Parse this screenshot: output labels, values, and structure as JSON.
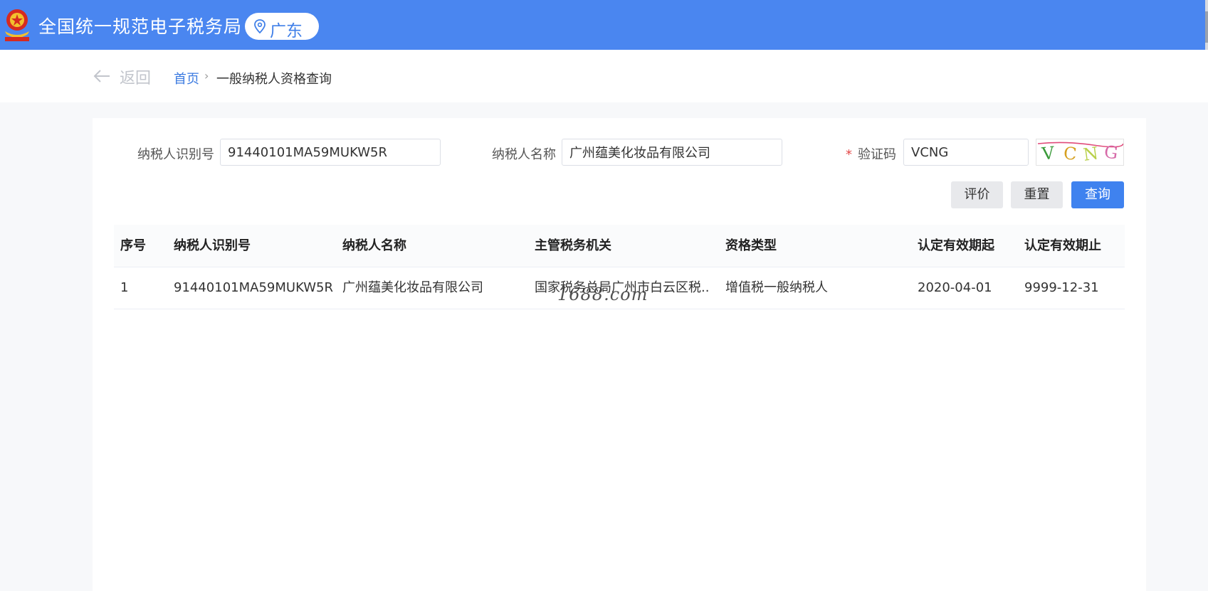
{
  "header": {
    "title": "全国统一规范电子税务局",
    "region": "广东",
    "emblem_icon": "national-emblem-icon",
    "region_icon": "location-pin-icon",
    "brand_color": "#4a86f0"
  },
  "nav": {
    "back_label": "返回",
    "breadcrumb": {
      "home": "首页",
      "separator": "›",
      "current": "一般纳税人资格查询"
    }
  },
  "form": {
    "taxpayer_id_label": "纳税人识别号",
    "taxpayer_id_value": "91440101MA59MUKW5R",
    "taxpayer_name_label": "纳税人名称",
    "taxpayer_name_value": "广州蕴美化妆品有限公司",
    "captcha_required_mark": "*",
    "captcha_label": "验证码",
    "captcha_value": "VCNG",
    "captcha_image_text": "VCNG"
  },
  "buttons": {
    "evaluate": "评价",
    "reset": "重置",
    "query": "查询"
  },
  "table": {
    "columns": [
      "序号",
      "纳税人识别号",
      "纳税人名称",
      "主管税务机关",
      "资格类型",
      "认定有效期起",
      "认定有效期止"
    ],
    "rows": [
      [
        "1",
        "91440101MA59MUKW5R",
        "广州蕴美化妆品有限公司",
        "国家税务总局广州市白云区税...",
        "增值税一般纳税人",
        "2020-04-01",
        "9999-12-31"
      ]
    ]
  },
  "watermark": "1688.com"
}
